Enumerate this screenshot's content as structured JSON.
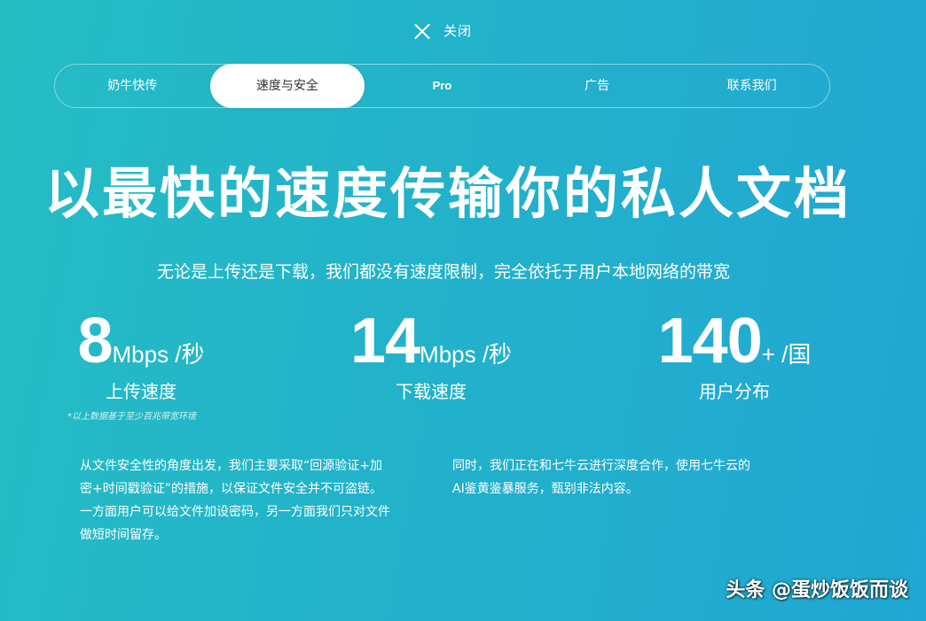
{
  "close": {
    "icon": "close-icon",
    "label": "关闭"
  },
  "tabs": [
    {
      "label": "奶牛快传",
      "active": false
    },
    {
      "label": "速度与安全",
      "active": true
    },
    {
      "label": "Pro",
      "active": false
    },
    {
      "label": "广告",
      "active": false
    },
    {
      "label": "联系我们",
      "active": false
    }
  ],
  "hero": {
    "headline": "以最快的速度传输你的私人文档",
    "subline": "无论是上传还是下载，我们都没有速度限制，完全依托于用户本地网络的带宽"
  },
  "stats": {
    "upload": {
      "value": "8",
      "unit": "Mbps /秒",
      "label": "上传速度"
    },
    "download": {
      "value": "14",
      "unit": "Mbps /秒",
      "label": "下载速度"
    },
    "users": {
      "value": "140",
      "unit": "+ /国",
      "label": "用户分布"
    }
  },
  "footnote": "*以上数据基于至少百兆带宽环境",
  "paragraphs": {
    "left": "从文件安全性的角度出发，我们主要采取“回源验证+加\n密+时间戳验证”的措施，以保证文件安全并不可盗链。\n一方面用户可以给文件加设密码，另一方面我们只对文件\n做短时间留存。",
    "right": "同时，我们正在和七牛云进行深度合作，使用七牛云的\nAI鉴黄鉴暴服务，甄别非法内容。"
  },
  "watermark": "头条 @蛋炒饭饭而谈",
  "colors": {
    "background_start": "#25bdc4",
    "background_end": "#21a7d3",
    "active_tab_bg": "#ffffff",
    "active_tab_text": "#333333"
  }
}
